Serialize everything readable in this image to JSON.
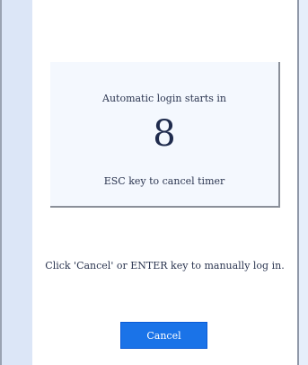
{
  "timer": {
    "label": "Automatic login starts in",
    "value": "8",
    "esc_hint": "ESC key to cancel timer"
  },
  "manual_hint": "Click 'Cancel' or ENTER key to manually log in.",
  "buttons": {
    "cancel_label": "Cancel"
  },
  "colors": {
    "background": "#e9f0fb",
    "panel": "#ffffff",
    "timer_box": "#f4f8fe",
    "accent": "#1a73e8",
    "text": "#2b3550"
  }
}
